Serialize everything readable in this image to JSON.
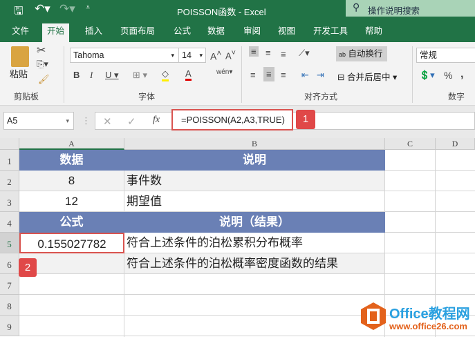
{
  "title": "POISSON函数  -  Excel",
  "search_placeholder": "操作说明搜索",
  "tabs": [
    "文件",
    "开始",
    "插入",
    "页面布局",
    "公式",
    "数据",
    "审阅",
    "视图",
    "开发工具",
    "帮助"
  ],
  "ribbon": {
    "paste": "粘贴",
    "clipboard": "剪贴板",
    "font_name": "Tahoma",
    "font_size": "14",
    "font_group": "字体",
    "wrap": "自动换行",
    "merge": "合并后居中",
    "align_group": "对齐方式",
    "number_format": "常规",
    "number_group": "数字",
    "percent": "%",
    "comma": ","
  },
  "name_box": "A5",
  "formula": "=POISSON(A2,A3,TRUE)",
  "callouts": [
    "1",
    "2"
  ],
  "columns": [
    "A",
    "B",
    "C",
    "D"
  ],
  "rows": [
    "1",
    "2",
    "3",
    "4",
    "5",
    "6",
    "7",
    "8",
    "9"
  ],
  "cells": {
    "r1": [
      "数据",
      "说明"
    ],
    "r2": [
      "8",
      "事件数"
    ],
    "r3": [
      "12",
      "期望值"
    ],
    "r4": [
      "公式",
      "说明（结果）"
    ],
    "r5": [
      "0.155027782",
      "符合上述条件的泊松累积分布概率"
    ],
    "r6": [
      "",
      "符合上述条件的泊松概率密度函数的结果"
    ]
  },
  "watermark": {
    "brand": "Office教程网",
    "url": "www.office26.com"
  },
  "colors": {
    "excel_green": "#217346",
    "header_blue": "#6a80b5",
    "callout_red": "#e04848"
  }
}
